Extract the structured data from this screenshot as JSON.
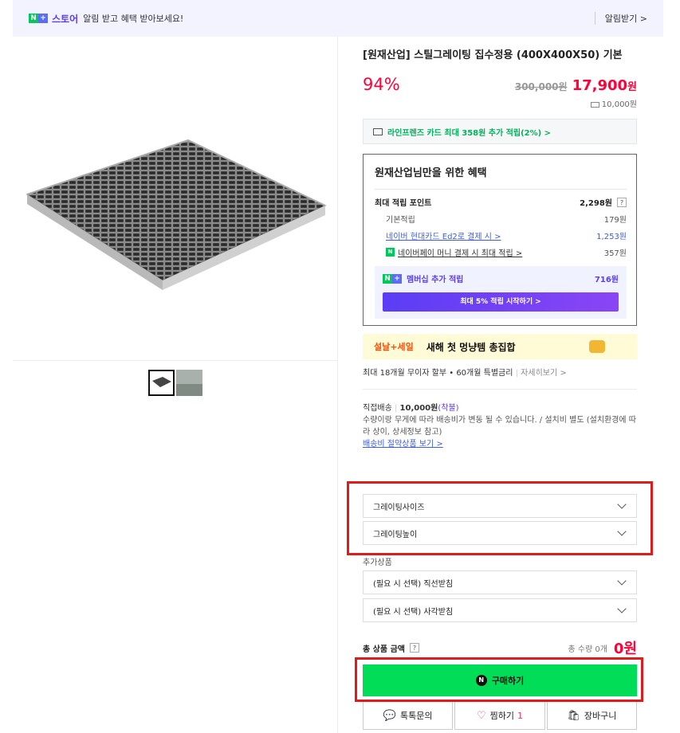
{
  "topbar": {
    "brand_store": "스토어",
    "notice": "알림 받고 혜택 받아보세요!",
    "alarm_label": "알림받기 >"
  },
  "product": {
    "title": "[원재산업] 스틸그레이팅 집수정용 (400X400X50) 기본",
    "discount": "94%",
    "original_price": "300,000원",
    "sale_price": "17,900",
    "sale_unit": "원",
    "shipping_fee": "10,000원"
  },
  "card_benefit": {
    "text": "라인프렌즈 카드 최대 358원 추가 적립(2%) >"
  },
  "benefit": {
    "title": "원재산업님만을 위한 혜택",
    "max_points_label": "최대 적립 포인트",
    "max_points_value": "2,298원",
    "items": [
      {
        "label": "기본적립",
        "value": "179원"
      },
      {
        "label": "네이버 현대카드 Ed2로 결제 시 >",
        "value": "1,253원"
      },
      {
        "label": "네이버페이 머니 결제 시 최대 적립 >",
        "value": "357원"
      }
    ],
    "membership_label": "멤버십 추가 적립",
    "membership_value": "716원",
    "membership_button": "최대 5% 적립 시작하기 >"
  },
  "banner": {
    "tag": "설날+세일",
    "message": "새해 첫 멍냥템 총집합"
  },
  "installment": {
    "text": "최대 18개월 무이자 할부 • 60개월 특별금리",
    "link": "자세히보기 >"
  },
  "delivery": {
    "label": "직접배송",
    "price": "10,000원",
    "type": "(착불)",
    "note": "수량이랑 무게에 따라 배송비가 변동 될 수 있습니다. / 설치비 별도 (설치환경에 따라 상이, 상세정보 참고)",
    "link": "배송비 절약상품 보기 >"
  },
  "options": {
    "select1": "그레이팅사이즈",
    "select2": "그레이팅높이",
    "additional_label": "추가상품",
    "add1": "(필요 시 선택) 직선받침",
    "add2": "(필요 시 선택) 사각받침"
  },
  "total": {
    "label": "총 상품 금액",
    "qty": "총 수량 0개",
    "amount": "0원"
  },
  "buttons": {
    "buy": "구매하기",
    "talk": "톡톡문의",
    "wish": "찜하기",
    "wish_count": "1",
    "cart": "장바구니"
  },
  "colors": {
    "accent": "#ff0038",
    "buy_green": "#02dd58",
    "highlight_red": "#e11a1a"
  }
}
